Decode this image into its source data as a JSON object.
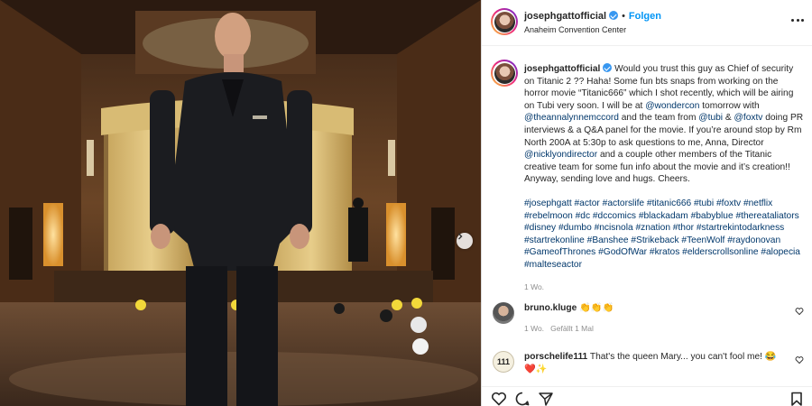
{
  "header": {
    "username": "josephgattofficial",
    "separator": "•",
    "follow_label": "Folgen",
    "location": "Anaheim Convention Center",
    "more_icon": "more-horizontal-icon"
  },
  "caption": {
    "username": "josephgattofficial",
    "text_parts": [
      " Would you trust this guy as Chief of security on Titanic 2 ?? Haha! Some fun bts snaps from working on the horror movie “Titanic666” which I shot recently, which will be airing on Tubi very soon. I will be at ",
      "@wondercon",
      " tomorrow with ",
      "@theannalynnemccord",
      " and the team from ",
      "@tubi",
      " & ",
      "@foxtv",
      " doing PR interviews & a Q&A panel for the movie. If you’re around stop by Rm North 200A at 5:30p to ask questions to me, Anna, Director ",
      "@nicklyondirector",
      " and a couple other members of the Titanic creative team for some fun info about the movie and it’s creation!! Anyway, sending love and hugs. Cheers."
    ],
    "hashtags": "#josephgatt #actor #actorslife #titanic666 #tubi #foxtv #netflix #rebelmoon #dc #dccomics #blackadam #babyblue #thereataliators #disney #dumbo #ncisnola #znation #thor #startrekintodarkness #startrekonline #Banshee #Strikeback #TeenWolf #raydonovan #GameofThrones #GodOfWar #kratos #elderscrollsonline #alopecia #malteseactor",
    "time": "1 Wo."
  },
  "comments": [
    {
      "username": "bruno.kluge",
      "text": " 👏👏👏",
      "time": "1 Wo.",
      "likes": "Gefällt 1 Mal"
    },
    {
      "username": "porschelife111",
      "text": " That's the queen Mary... you can't fool me! 😂",
      "extra": "❤️✨",
      "avatar_label": "111"
    }
  ],
  "actions": {
    "icons": [
      "heart-icon",
      "comment-icon",
      "share-icon",
      "bookmark-icon"
    ]
  },
  "colors": {
    "link": "#00376b",
    "follow": "#0095f6",
    "verified": "#3897f0",
    "muted": "#8e8e8e"
  }
}
